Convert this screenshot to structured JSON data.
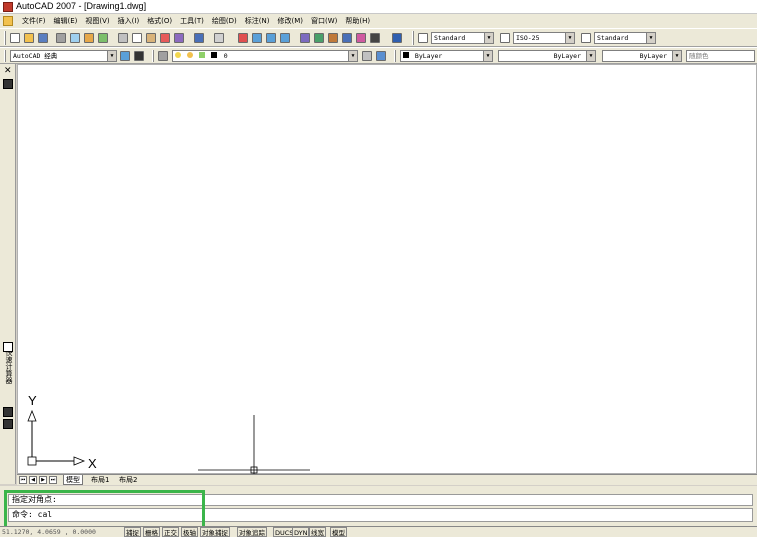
{
  "window": {
    "title": "AutoCAD 2007 - [Drawing1.dwg]"
  },
  "menu": [
    "文件(F)",
    "编辑(E)",
    "视图(V)",
    "插入(I)",
    "格式(O)",
    "工具(T)",
    "绘图(D)",
    "标注(N)",
    "修改(M)",
    "窗口(W)",
    "帮助(H)"
  ],
  "styles": {
    "text_style": "Standard",
    "dim_style": "ISO-25",
    "table_style": "Standard"
  },
  "workspace": "AutoCAD 经典",
  "layer": "0",
  "properties": {
    "color": "ByLayer",
    "linetype": "ByLayer",
    "lineweight": "ByLayer",
    "plotstyle": "随颜色"
  },
  "side_palette": {
    "label": "快速计算器"
  },
  "ucs": {
    "x_label": "X",
    "y_label": "Y"
  },
  "layout_tabs": [
    "模型",
    "布局1",
    "布局2"
  ],
  "command": {
    "history": "指定对角点:",
    "prompt": "命令: cal"
  },
  "status": {
    "coords": "51.1270, 4.0659 , 0.0000",
    "toggles": [
      "捕捉",
      "栅格",
      "正交",
      "极轴",
      "对象捕捉",
      "对象追踪",
      "DUCS",
      "DYN",
      "线宽",
      "模型"
    ]
  },
  "colors": {
    "highlight": "#3bb54a"
  }
}
